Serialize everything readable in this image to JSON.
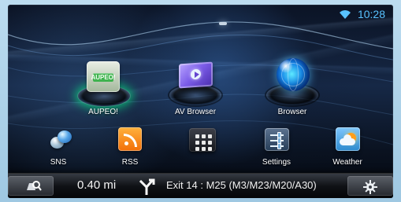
{
  "status": {
    "time": "10:28",
    "wifi_icon": "wifi-icon",
    "accent_color": "#58c2ff"
  },
  "apps": {
    "large": [
      {
        "label": "AUPEO!",
        "icon": "aupeo-icon",
        "logo_text": "AUPEO!"
      },
      {
        "label": "AV Browser",
        "icon": "av-browser-icon"
      },
      {
        "label": "Browser",
        "icon": "browser-globe-icon"
      }
    ],
    "small": [
      {
        "label": "SNS",
        "icon": "sns-icon"
      },
      {
        "label": "RSS",
        "icon": "rss-icon"
      },
      {
        "label": "Settings",
        "icon": "settings-icon"
      },
      {
        "label": "Weather",
        "icon": "weather-icon"
      }
    ],
    "grid_button_icon": "app-grid-icon"
  },
  "navigation": {
    "distance": "0.40 mi",
    "route": "Exit 14 : M25 (M3/M23/M20/A30)",
    "left_icon": "map-search-icon",
    "turn_icon": "fork-turn-icon",
    "right_icon": "gear-icon"
  }
}
